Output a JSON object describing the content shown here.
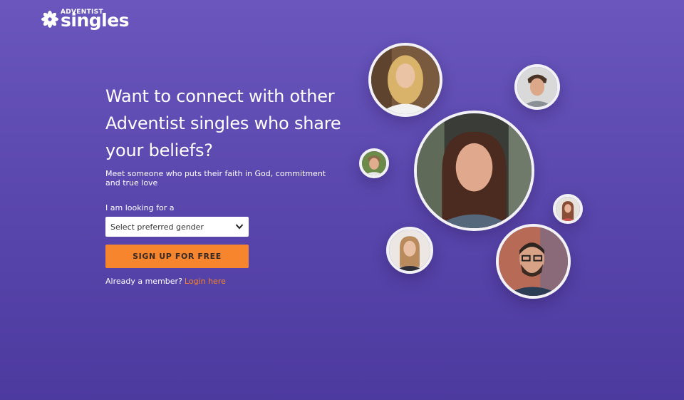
{
  "brand": {
    "top": "ADVENTIST",
    "main": "singles"
  },
  "hero": {
    "headline_line1": "Want to connect with other",
    "headline_line2": "Adventist singles who share",
    "headline_line3": "your beliefs?",
    "subtext": "Meet someone who puts their faith in God, commitment and true love",
    "looking_label": "I am looking for a",
    "gender_select": "Select preferred gender",
    "cta": "SIGN UP FOR FREE",
    "member_text": "Already a member?",
    "login_link": "Login here"
  },
  "colors": {
    "background": "#5a47ad",
    "accent": "#f7852d"
  },
  "icons": {
    "logo": "flower-logo-icon",
    "select": "chevron-down-icon"
  }
}
